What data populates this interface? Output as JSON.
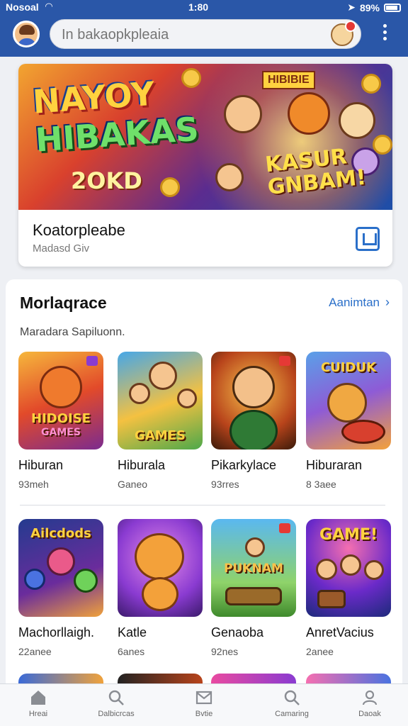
{
  "status": {
    "carrier": "Nosoal",
    "time": "1:80",
    "battery": "89%"
  },
  "header": {
    "search_placeholder": "In bakaopkpleaia"
  },
  "hero": {
    "title_line1": "NAYOY",
    "title_line2": "HIBAKAS",
    "subtitle": "2OKD",
    "sign": "HIBIBIE",
    "tag_line1": "KASUR",
    "tag_line2": "GNBAM!",
    "name": "Koatorpleabe",
    "meta": "Madasd Giv"
  },
  "section": {
    "title": "Morlaqrace",
    "see_all": "Aanimtan",
    "subtitle": "Maradara Sapiluonn.",
    "items": [
      {
        "name": "Hiburan",
        "meta": "93meh",
        "art_text": "HIDOISE",
        "art_text2": "GAMES"
      },
      {
        "name": "Hiburala",
        "meta": "Ganeo",
        "art_text": "GAMES",
        "art_text2": ""
      },
      {
        "name": "Pikarkylace",
        "meta": "93rres",
        "art_text": "",
        "art_text2": ""
      },
      {
        "name": "Hiburaran",
        "meta": "8 3aee",
        "art_text": "CUIDUK",
        "art_text2": ""
      },
      {
        "name": "Machorllaigh.",
        "meta": "22anee",
        "art_text": "Ailcdods",
        "art_text2": ""
      },
      {
        "name": "Katle",
        "meta": "6anes",
        "art_text": "",
        "art_text2": ""
      },
      {
        "name": "Genaoba",
        "meta": "92nes",
        "art_text": "PUKNAM",
        "art_text2": ""
      },
      {
        "name": "AnretVacius",
        "meta": "2anee",
        "art_text": "GAME!",
        "art_text2": ""
      }
    ]
  },
  "nav": [
    {
      "label": "Hreai",
      "icon": "home-icon"
    },
    {
      "label": "Dalbicrcas",
      "icon": "search-icon"
    },
    {
      "label": "Bvtie",
      "icon": "mail-icon"
    },
    {
      "label": "Camaring",
      "icon": "search-icon"
    },
    {
      "label": "Daoak",
      "icon": "person-icon"
    }
  ]
}
